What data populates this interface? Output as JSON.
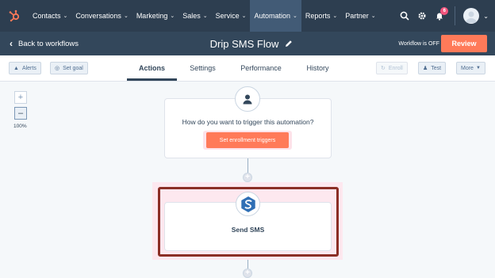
{
  "nav": {
    "logo_icon": "hubspot-sprocket-icon",
    "items": [
      {
        "label": "Contacts"
      },
      {
        "label": "Conversations"
      },
      {
        "label": "Marketing"
      },
      {
        "label": "Sales"
      },
      {
        "label": "Service"
      },
      {
        "label": "Automation",
        "active": true
      },
      {
        "label": "Reports"
      },
      {
        "label": "Partner"
      }
    ],
    "notification_count": "6",
    "icons": [
      "search-icon",
      "settings-gear-icon",
      "notifications-bell-icon",
      "user-avatar"
    ]
  },
  "header": {
    "back_label": "Back to workflows",
    "title": "Drip SMS Flow",
    "status": "Workflow is OFF",
    "review_label": "Review"
  },
  "toolbar": {
    "alerts_label": "Alerts",
    "set_goal_label": "Set goal",
    "tabs": [
      {
        "label": "Actions",
        "active": true
      },
      {
        "label": "Settings"
      },
      {
        "label": "Performance"
      },
      {
        "label": "History"
      }
    ],
    "enroll_label": "Enroll",
    "test_label": "Test",
    "more_label": "More"
  },
  "canvas": {
    "zoom_level": "100%",
    "trigger_question": "How do you want to trigger this automation?",
    "trigger_button": "Set enrollment triggers",
    "action_label": "Send SMS"
  },
  "colors": {
    "nav_bg": "#2d3e50",
    "header_bg": "#33475b",
    "accent": "#ff7a59",
    "highlight_border": "#8b2e25"
  }
}
